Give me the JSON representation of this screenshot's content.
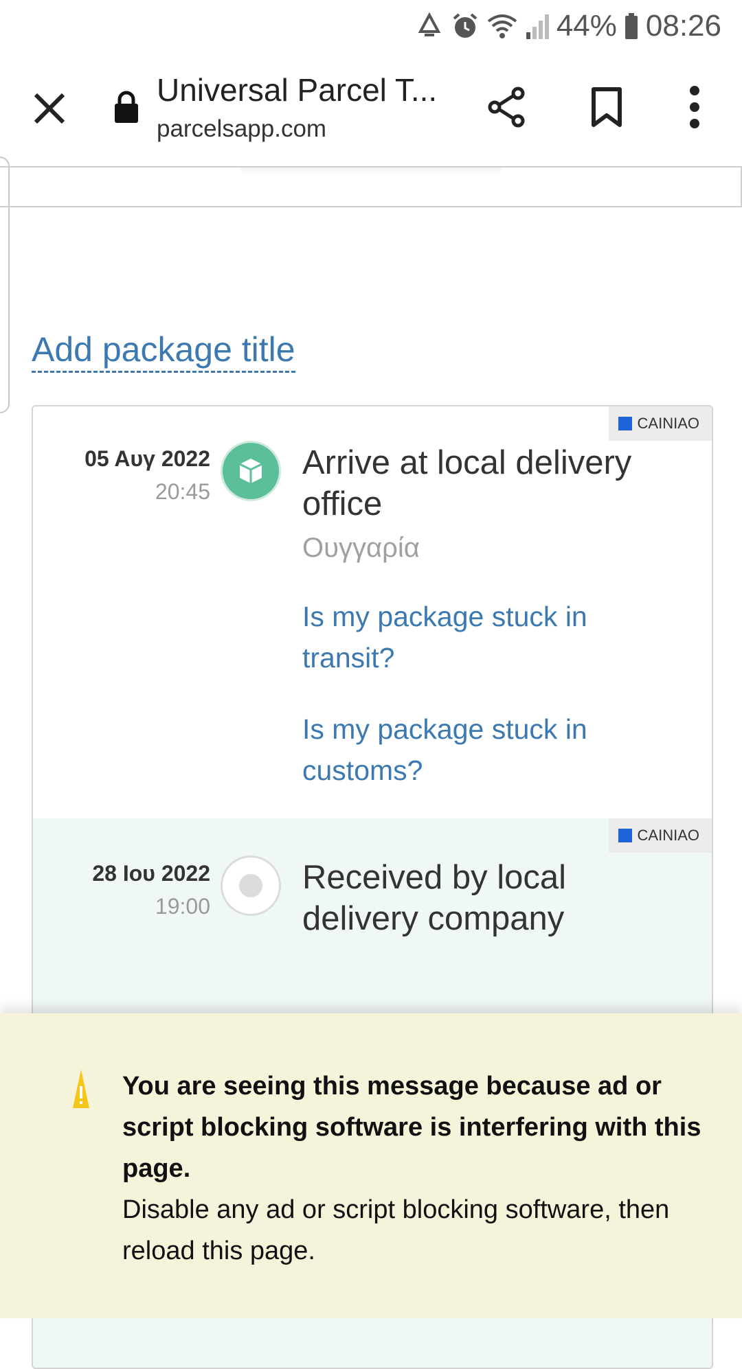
{
  "status_bar": {
    "battery": "44%",
    "time": "08:26"
  },
  "toolbar": {
    "title": "Universal Parcel T...",
    "url": "parcelsapp.com"
  },
  "page": {
    "add_title_link": "Add package title"
  },
  "events": [
    {
      "date": "05 Αυγ 2022",
      "time": "20:45",
      "carrier": "CAINIAO",
      "title": "Arrive at local delivery office",
      "location": "Ουγγαρία",
      "status": "active",
      "links": [
        "Is my package stuck in transit?",
        "Is my package stuck in customs?"
      ]
    },
    {
      "date": "28 Ιου 2022",
      "time": "19:00",
      "carrier": "CAINIAO",
      "title": "Received by local delivery company",
      "status": "inactive"
    }
  ],
  "notice": {
    "heading": "You are seeing this message because ad or script blocking software is interfering with this page.",
    "body": "Disable any ad or script blocking software, then reload this page."
  },
  "colors": {
    "accent_link": "#3b79b0",
    "active_node": "#5bbf9a",
    "notice_bg": "#f6f3db"
  },
  "icons": [
    "recycle-icon",
    "alarm-icon",
    "wifi-icon",
    "signal-icon",
    "battery-icon",
    "close-icon",
    "lock-icon",
    "share-icon",
    "bookmark-icon",
    "more-vert-icon",
    "package-icon",
    "warning-icon"
  ]
}
